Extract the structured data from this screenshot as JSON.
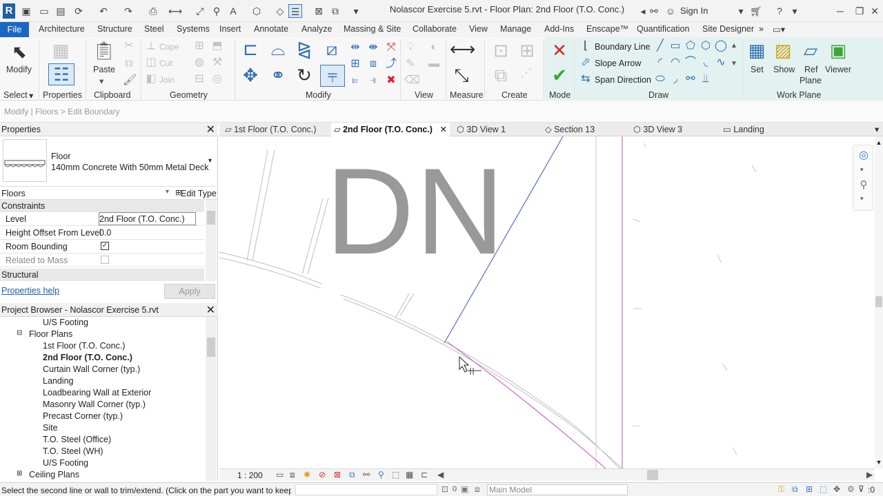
{
  "app": {
    "title": "Nolascor Exercise 5.rvt - Floor Plan: 2nd Floor (T.O. Conc.)",
    "sign_in": "Sign In",
    "logo_letter": "R"
  },
  "ribbon_tabs": [
    "File",
    "Architecture",
    "Structure",
    "Steel",
    "Systems",
    "Insert",
    "Annotate",
    "Analyze",
    "Massing & Site",
    "Collaborate",
    "View",
    "Manage",
    "Add-Ins",
    "Enscape™",
    "Quantification",
    "Site Designer"
  ],
  "ribbon": {
    "modify_label": "Modify",
    "select_label": "Select",
    "properties_label": "Properties",
    "paste_label": "Paste",
    "clipboard_label": "Clipboard",
    "cope_label": "Cope",
    "cut_label": "Cut",
    "join_label": "Join",
    "geometry_label": "Geometry",
    "modify_group_label": "Modify",
    "view_label": "View",
    "measure_label": "Measure",
    "create_label": "Create",
    "mode_label": "Mode",
    "boundary_line": "Boundary Line",
    "slope_arrow": "Slope Arrow",
    "span_direction": "Span Direction",
    "draw_label": "Draw",
    "set_label": "Set",
    "show_label": "Show",
    "ref_label": "Ref",
    "plane_label": "Plane",
    "viewer_label": "Viewer",
    "work_plane_label": "Work Plane"
  },
  "breadcrumb": "Modify | Floors > Edit Boundary",
  "properties": {
    "title": "Properties",
    "type_family": "Floor",
    "type_name": "140mm Concrete With 50mm Metal Deck",
    "category": "Floors",
    "edit_type": "Edit Type",
    "constraints_label": "Constraints",
    "rows": [
      {
        "key": "Level",
        "value": "2nd Floor (T.O. Conc.)"
      },
      {
        "key": "Height Offset From Level",
        "value": "0.0"
      },
      {
        "key": "Room Bounding",
        "value": ""
      },
      {
        "key": "Related to Mass",
        "value": ""
      }
    ],
    "room_bounding_checked": true,
    "related_to_mass_checked": false,
    "structural_label": "Structural",
    "help": "Properties help",
    "apply": "Apply"
  },
  "project_browser": {
    "title": "Project Browser - Nolascor Exercise 5.rvt",
    "items": [
      {
        "label": "U/S Footing",
        "level": 2
      },
      {
        "label": "Floor Plans",
        "level": 1
      },
      {
        "label": "1st Floor (T.O. Conc.)",
        "level": 2
      },
      {
        "label": "2nd Floor (T.O. Conc.)",
        "level": 2,
        "active": true
      },
      {
        "label": "Curtain Wall Corner (typ.)",
        "level": 2
      },
      {
        "label": "Landing",
        "level": 2
      },
      {
        "label": "Loadbearing Wall at Exterior",
        "level": 2
      },
      {
        "label": "Masonry Wall Corner (typ.)",
        "level": 2
      },
      {
        "label": "Precast Corner (typ.)",
        "level": 2
      },
      {
        "label": "Site",
        "level": 2
      },
      {
        "label": "T.O. Steel (Office)",
        "level": 2
      },
      {
        "label": "T.O. Steel (WH)",
        "level": 2
      },
      {
        "label": "U/S Footing",
        "level": 2
      },
      {
        "label": "Ceiling Plans",
        "level": 1
      }
    ]
  },
  "view_tabs": [
    {
      "label": "1st Floor (T.O. Conc.)",
      "active": false
    },
    {
      "label": "2nd Floor (T.O. Conc.)",
      "active": true
    },
    {
      "label": "3D View 1",
      "active": false
    },
    {
      "label": "Section 13",
      "active": false
    },
    {
      "label": "3D View 3",
      "active": false
    },
    {
      "label": "Landing",
      "active": false
    }
  ],
  "canvas": {
    "annotation_text": "DN"
  },
  "view_bar": {
    "scale": "1 : 200"
  },
  "status": {
    "prompt": "Select the second line or wall to trim/extend.  (Click on the part you want to keep.)",
    "workset": "Main Model",
    "filter_count": ":0"
  }
}
